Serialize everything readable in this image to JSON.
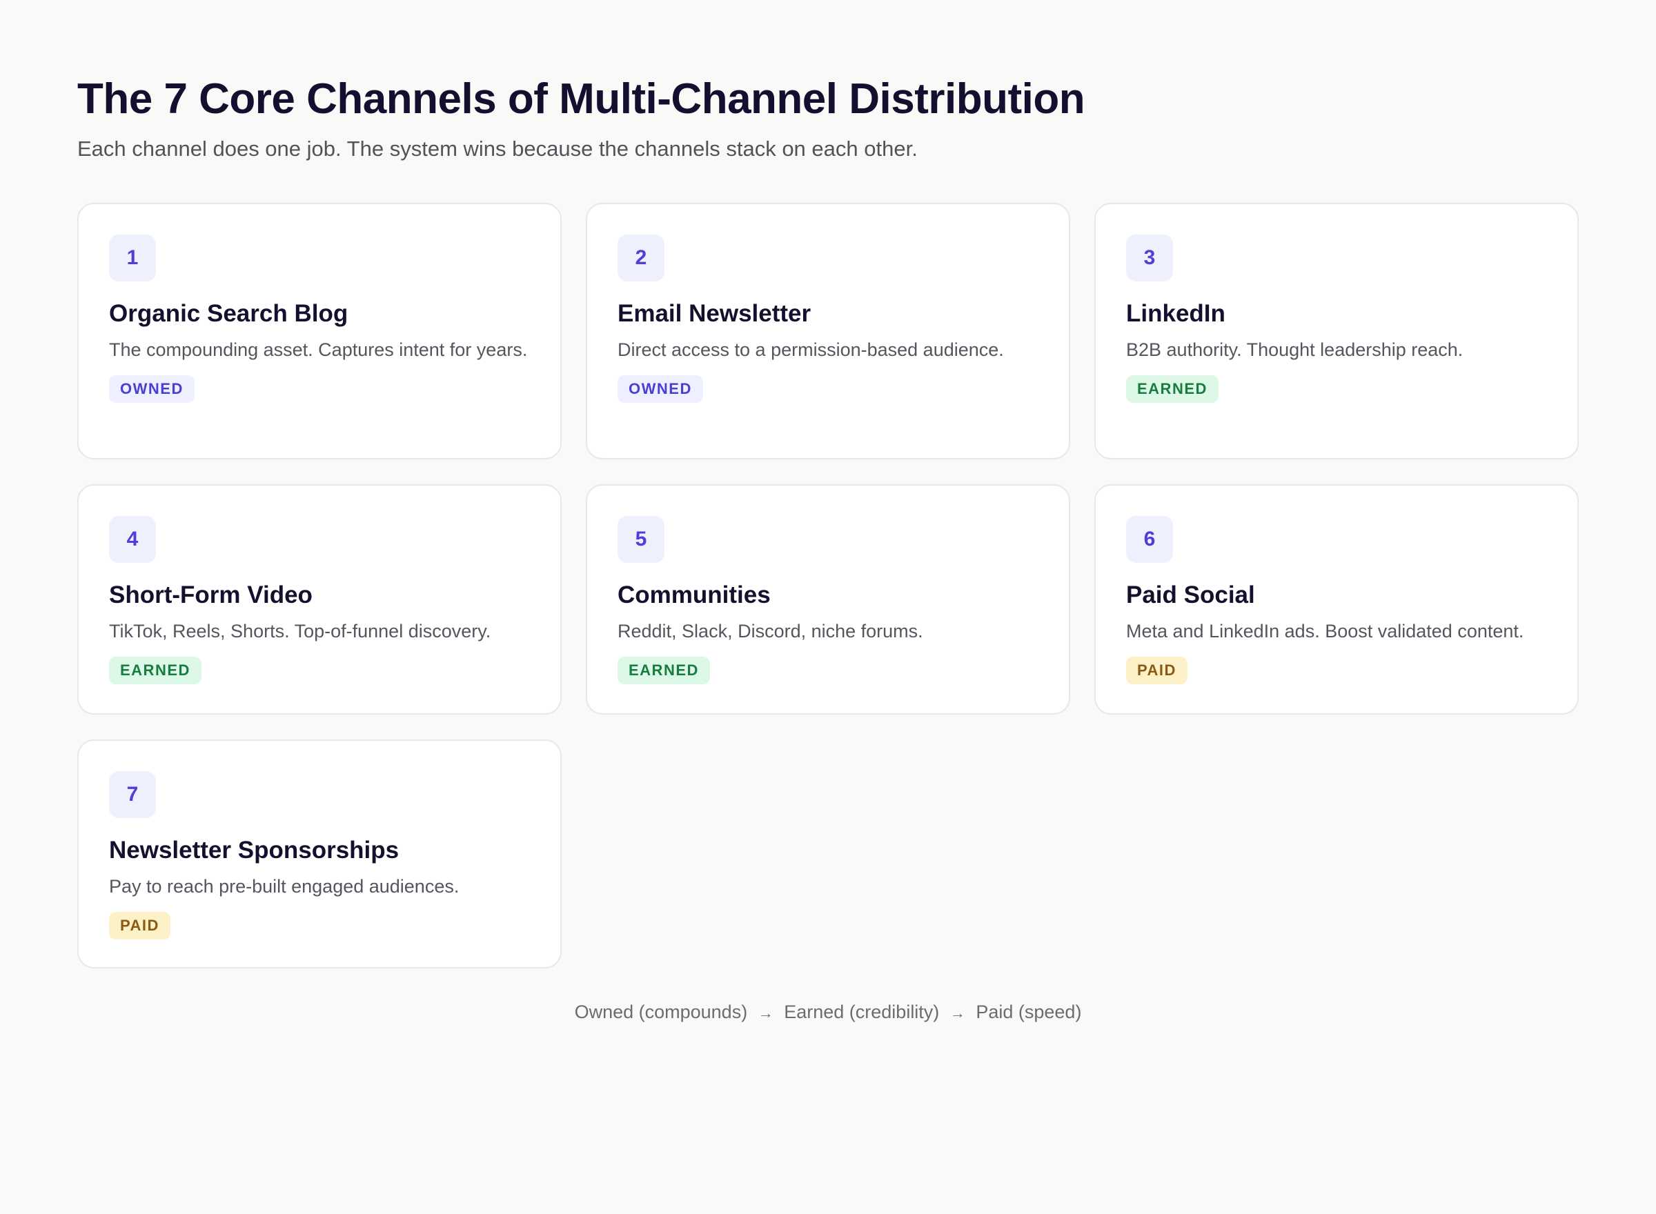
{
  "header": {
    "title": "The 7 Core Channels of Multi-Channel Distribution",
    "subtitle": "Each channel does one job. The system wins because the channels stack on each other."
  },
  "channels": [
    {
      "number": "1",
      "name": "Organic Search Blog",
      "description": "The compounding asset. Captures intent for years.",
      "tag": "OWNED"
    },
    {
      "number": "2",
      "name": "Email Newsletter",
      "description": "Direct access to a permission-based audience.",
      "tag": "OWNED"
    },
    {
      "number": "3",
      "name": "LinkedIn",
      "description": "B2B authority. Thought leadership reach.",
      "tag": "EARNED"
    },
    {
      "number": "4",
      "name": "Short-Form Video",
      "description": "TikTok, Reels, Shorts. Top-of-funnel discovery.",
      "tag": "EARNED"
    },
    {
      "number": "5",
      "name": "Communities",
      "description": "Reddit, Slack, Discord, niche forums.",
      "tag": "EARNED"
    },
    {
      "number": "6",
      "name": "Paid Social",
      "description": "Meta and LinkedIn ads. Boost validated content.",
      "tag": "PAID"
    },
    {
      "number": "7",
      "name": "Newsletter Sponsorships",
      "description": "Pay to reach pre-built engaged audiences.",
      "tag": "PAID"
    }
  ],
  "tag_colors": {
    "OWNED": {
      "bg": "#eeefff",
      "fg": "#4a3fd4"
    },
    "EARNED": {
      "bg": "#ddf8e6",
      "fg": "#177d3f"
    },
    "PAID": {
      "bg": "#fdf1c8",
      "fg": "#8b5a12"
    }
  },
  "footer": {
    "step1": "Owned (compounds)",
    "step2": "Earned (credibility)",
    "step3": "Paid (speed)",
    "arrow": "→"
  }
}
